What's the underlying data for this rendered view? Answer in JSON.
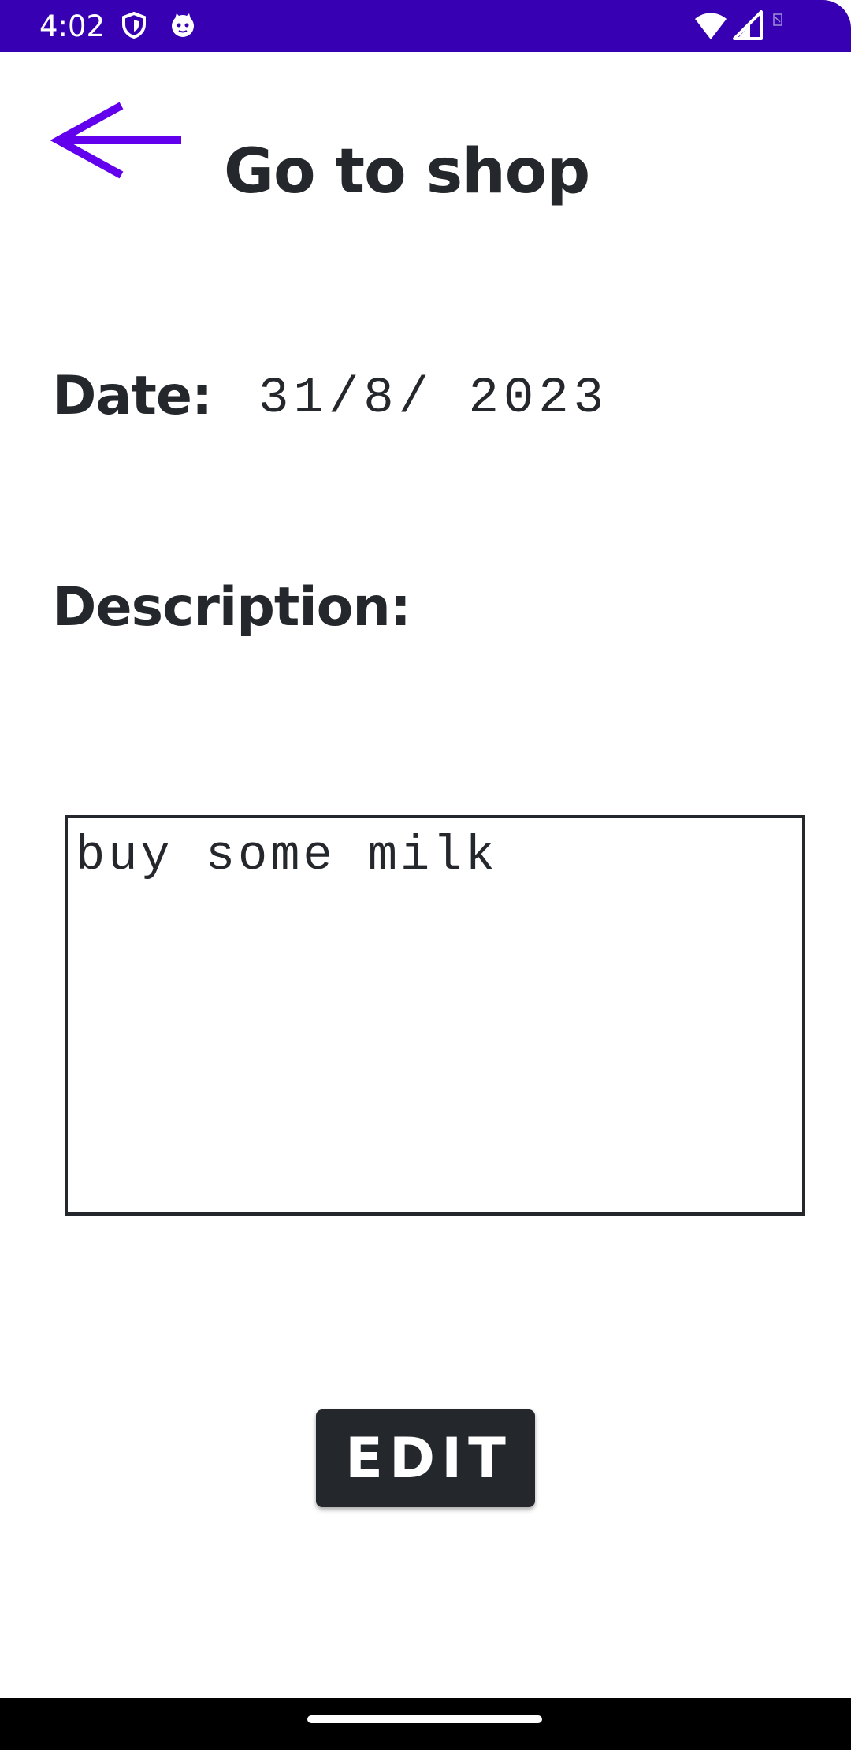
{
  "status_bar": {
    "time": "4:02",
    "background_color": "#3700b3",
    "icons": [
      "shield-icon",
      "cat-face-icon",
      "wifi-icon",
      "cellular-signal-icon",
      "no-sim-icon"
    ]
  },
  "header": {
    "back_icon": "arrow-back-icon",
    "title": "Go to shop",
    "accent_color": "#6200ee"
  },
  "details": {
    "date_label": "Date:",
    "date_value": "31/8/ 2023",
    "description_label": "Description:",
    "description_value": "buy some milk"
  },
  "actions": {
    "edit_label": "EDIT"
  },
  "colors": {
    "text": "#24272b",
    "button_bg": "#24272b",
    "button_text": "#ffffff"
  }
}
